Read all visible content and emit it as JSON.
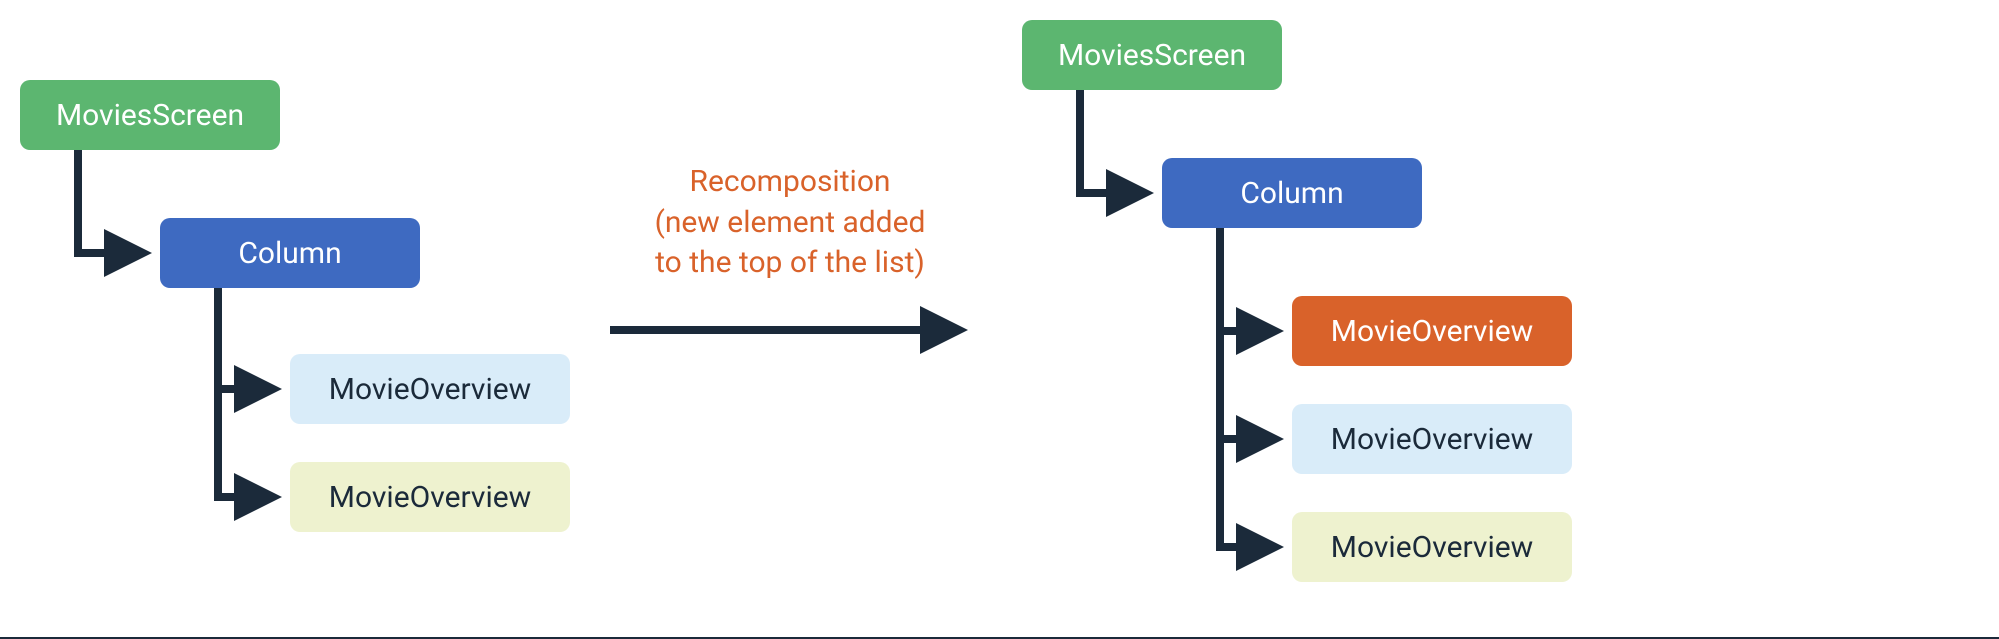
{
  "left_tree": {
    "root": "MoviesScreen",
    "column": "Column",
    "items": [
      {
        "label": "MovieOverview",
        "style": "lightblue"
      },
      {
        "label": "MovieOverview",
        "style": "lightyellow"
      }
    ]
  },
  "right_tree": {
    "root": "MoviesScreen",
    "column": "Column",
    "items": [
      {
        "label": "MovieOverview",
        "style": "orange"
      },
      {
        "label": "MovieOverview",
        "style": "lightblue"
      },
      {
        "label": "MovieOverview",
        "style": "lightyellow"
      }
    ]
  },
  "caption": {
    "line1": "Recomposition",
    "line2": "(new element added",
    "line3": "to the top of the list)"
  },
  "colors": {
    "green": "#5cb670",
    "blue": "#3e6ac1",
    "orange": "#d9622a",
    "lightblue": "#d9ecf9",
    "lightyellow": "#eef2cf",
    "stroke": "#1b2a3a"
  }
}
